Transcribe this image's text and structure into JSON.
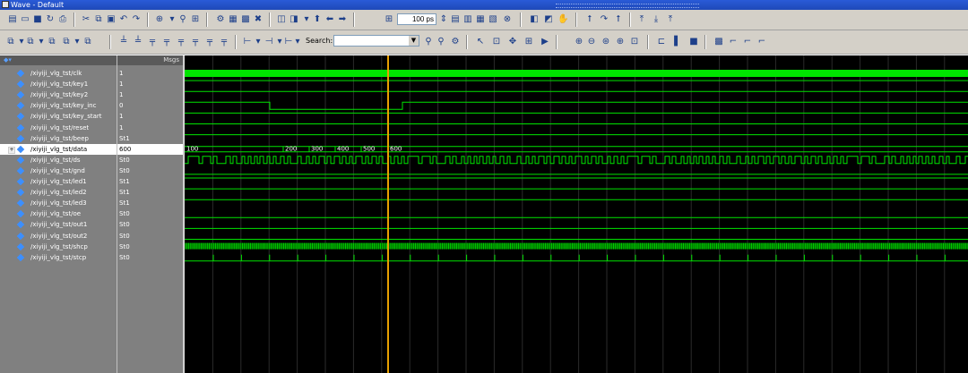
{
  "window": {
    "title": "Wave - Default"
  },
  "toolbar": {
    "zoom_value": "100 ps",
    "search_label": "Search:"
  },
  "header": {
    "msgs_label": "Msgs"
  },
  "signals": [
    {
      "name": "/xiyiji_vlg_tst/clk",
      "value": "1"
    },
    {
      "name": "/xiyiji_vlg_tst/key1",
      "value": "1"
    },
    {
      "name": "/xiyiji_vlg_tst/key2",
      "value": "1"
    },
    {
      "name": "/xiyiji_vlg_tst/key_inc",
      "value": "0"
    },
    {
      "name": "/xiyiji_vlg_tst/key_start",
      "value": "1"
    },
    {
      "name": "/xiyiji_vlg_tst/reset",
      "value": "1"
    },
    {
      "name": "/xiyiji_vlg_tst/beep",
      "value": "St1"
    },
    {
      "name": "/xiyiji_vlg_tst/data",
      "value": "600"
    },
    {
      "name": "/xiyiji_vlg_tst/ds",
      "value": "St0"
    },
    {
      "name": "/xiyiji_vlg_tst/gnd",
      "value": "St0"
    },
    {
      "name": "/xiyiji_vlg_tst/led1",
      "value": "St1"
    },
    {
      "name": "/xiyiji_vlg_tst/led2",
      "value": "St1"
    },
    {
      "name": "/xiyiji_vlg_tst/led3",
      "value": "St1"
    },
    {
      "name": "/xiyiji_vlg_tst/oe",
      "value": "St0"
    },
    {
      "name": "/xiyiji_vlg_tst/out1",
      "value": "St0"
    },
    {
      "name": "/xiyiji_vlg_tst/out2",
      "value": "St0"
    },
    {
      "name": "/xiyiji_vlg_tst/shcp",
      "value": "St0"
    },
    {
      "name": "/xiyiji_vlg_tst/stcp",
      "value": "St0"
    }
  ],
  "data_bus_labels": [
    "100",
    "200",
    "300",
    "400",
    "500",
    "600"
  ],
  "colors": {
    "wave": "#00e400",
    "cursor": "#e8a000",
    "grid": "#2b2b2b"
  }
}
